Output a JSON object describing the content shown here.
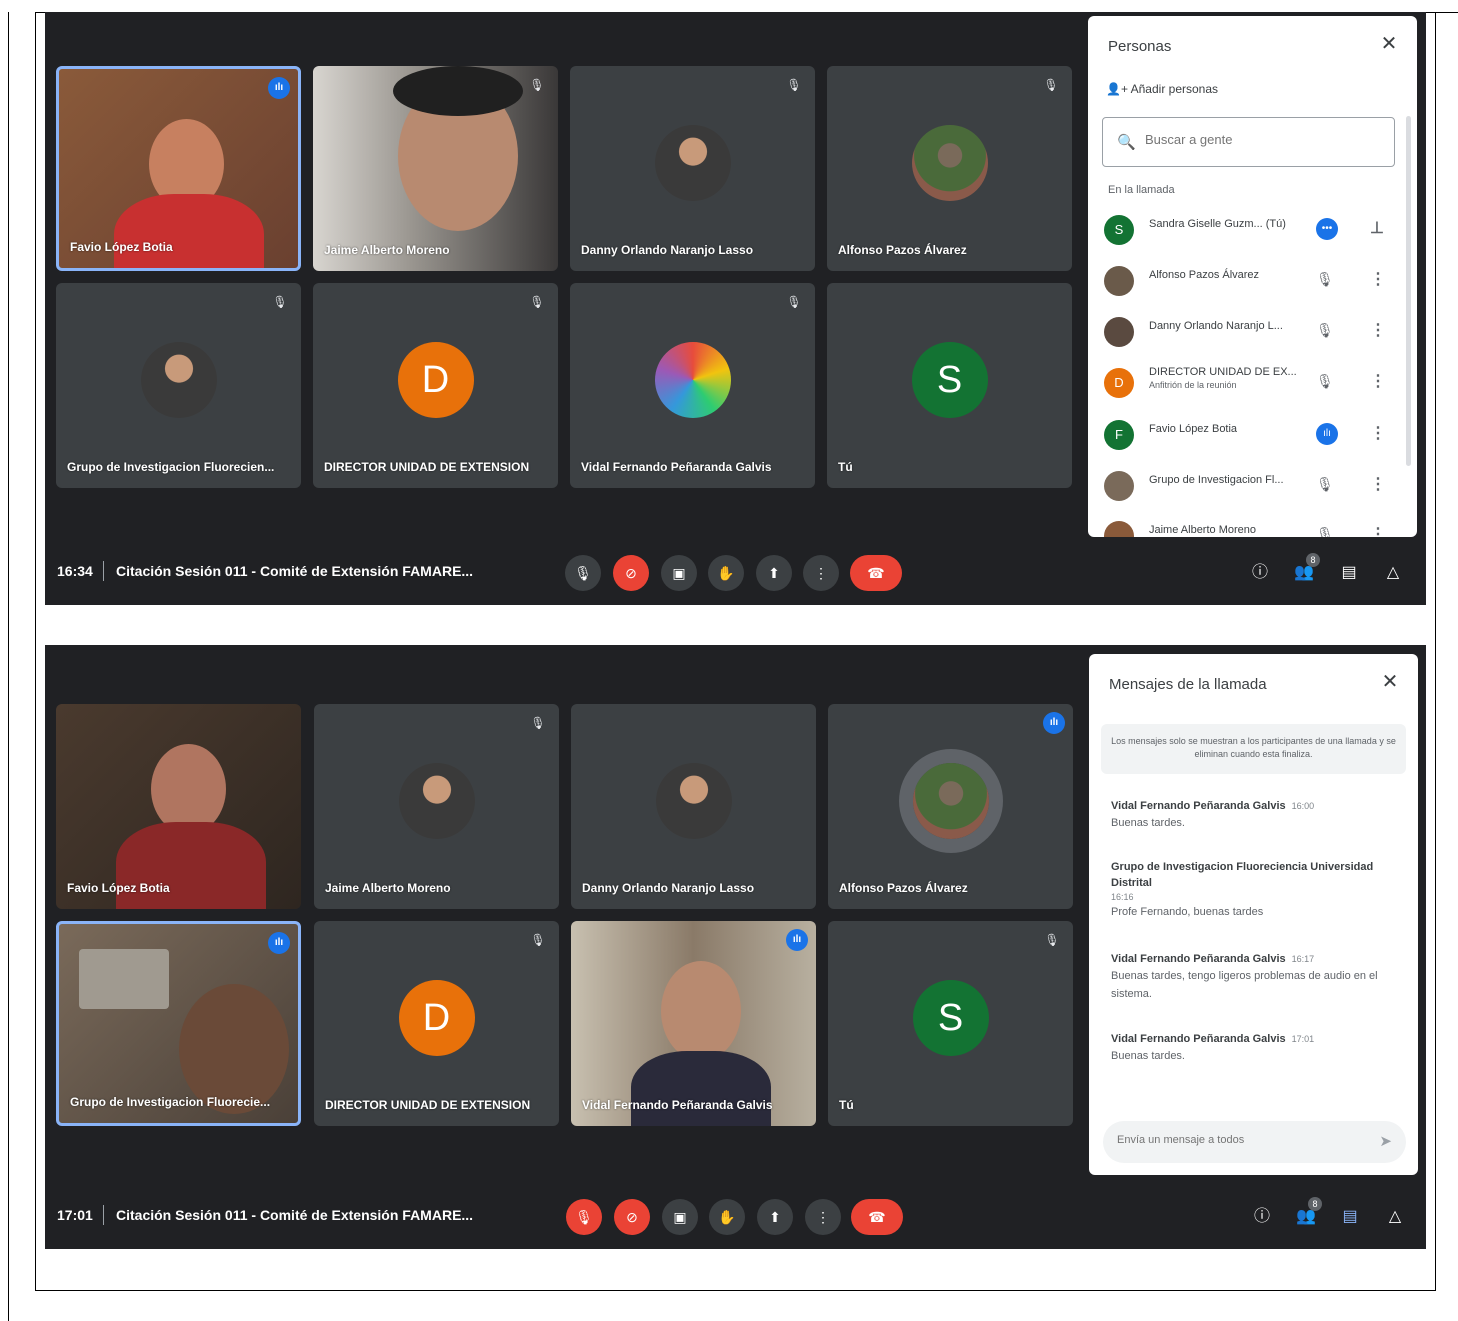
{
  "screen1": {
    "tiles": [
      {
        "name": "Favio López Botia"
      },
      {
        "name": "Jaime Alberto Moreno"
      },
      {
        "name": "Danny Orlando Naranjo Lasso"
      },
      {
        "name": "Alfonso Pazos Álvarez"
      },
      {
        "name": "Grupo de Investigacion Fluorecien..."
      },
      {
        "name": "DIRECTOR UNIDAD DE EXTENSION",
        "initial": "D"
      },
      {
        "name": "Vidal Fernando Peñaranda Galvis"
      },
      {
        "name": "Tú",
        "initial": "S"
      }
    ],
    "time": "16:34",
    "meeting_title": "Citación Sesión 011 - Comité de Extensión FAMARE...",
    "participants_count": "8",
    "people_panel": {
      "title": "Personas",
      "add_label": "Añadir personas",
      "search_placeholder": "Buscar a gente",
      "section": "En la llamada",
      "people": [
        {
          "name": "Sandra Giselle Guzm...  (Tú)",
          "initial": "S"
        },
        {
          "name": "Alfonso Pazos Álvarez"
        },
        {
          "name": "Danny Orlando Naranjo L..."
        },
        {
          "name": "DIRECTOR UNIDAD DE EX...",
          "sub": "Anfitrión de la reunión",
          "initial": "D"
        },
        {
          "name": "Favio López Botia",
          "initial": "F"
        },
        {
          "name": "Grupo de Investigacion Fl..."
        },
        {
          "name": "Jaime Alberto Moreno"
        }
      ]
    }
  },
  "screen2": {
    "tiles": [
      {
        "name": "Favio López Botia"
      },
      {
        "name": "Jaime Alberto Moreno"
      },
      {
        "name": "Danny Orlando Naranjo Lasso"
      },
      {
        "name": "Alfonso Pazos Álvarez"
      },
      {
        "name": "Grupo de Investigacion Fluorecie..."
      },
      {
        "name": "DIRECTOR UNIDAD DE EXTENSION",
        "initial": "D"
      },
      {
        "name": "Vidal Fernando Peñaranda Galvis"
      },
      {
        "name": "Tú",
        "initial": "S"
      }
    ],
    "time": "17:01",
    "meeting_title": "Citación Sesión 011 - Comité de Extensión FAMARE...",
    "participants_count": "8",
    "chat_panel": {
      "title": "Mensajes de la llamada",
      "note": "Los mensajes solo se muestran a los participantes de una llamada y se eliminan cuando esta finaliza.",
      "messages": [
        {
          "sender": "Vidal Fernando Peñaranda Galvis",
          "time": "16:00",
          "text": "Buenas tardes."
        },
        {
          "sender": "Grupo de Investigacion Fluoreciencia Universidad Distrital",
          "time": "16:16",
          "text": "Profe Fernando, buenas tardes"
        },
        {
          "sender": "Vidal Fernando Peñaranda Galvis",
          "time": "16:17",
          "text": "Buenas tardes, tengo ligeros problemas de audio en el sistema."
        },
        {
          "sender": "Vidal Fernando Peñaranda Galvis",
          "time": "17:01",
          "text": "Buenas tardes."
        }
      ],
      "input_placeholder": "Envía un mensaje a todos"
    }
  },
  "colors": {
    "bg": "#202124",
    "tile": "#3c4043",
    "red": "#ea4335",
    "blue": "#1a73e8",
    "orange": "#e8710a",
    "green": "#137333"
  },
  "icons": [
    "mic-icon",
    "camera-off-icon",
    "captions-icon",
    "raise-hand-icon",
    "present-icon",
    "more-icon",
    "hang-up-icon",
    "info-icon",
    "people-icon",
    "chat-icon",
    "activities-icon",
    "search-icon",
    "close-icon",
    "pin-icon",
    "send-icon"
  ]
}
